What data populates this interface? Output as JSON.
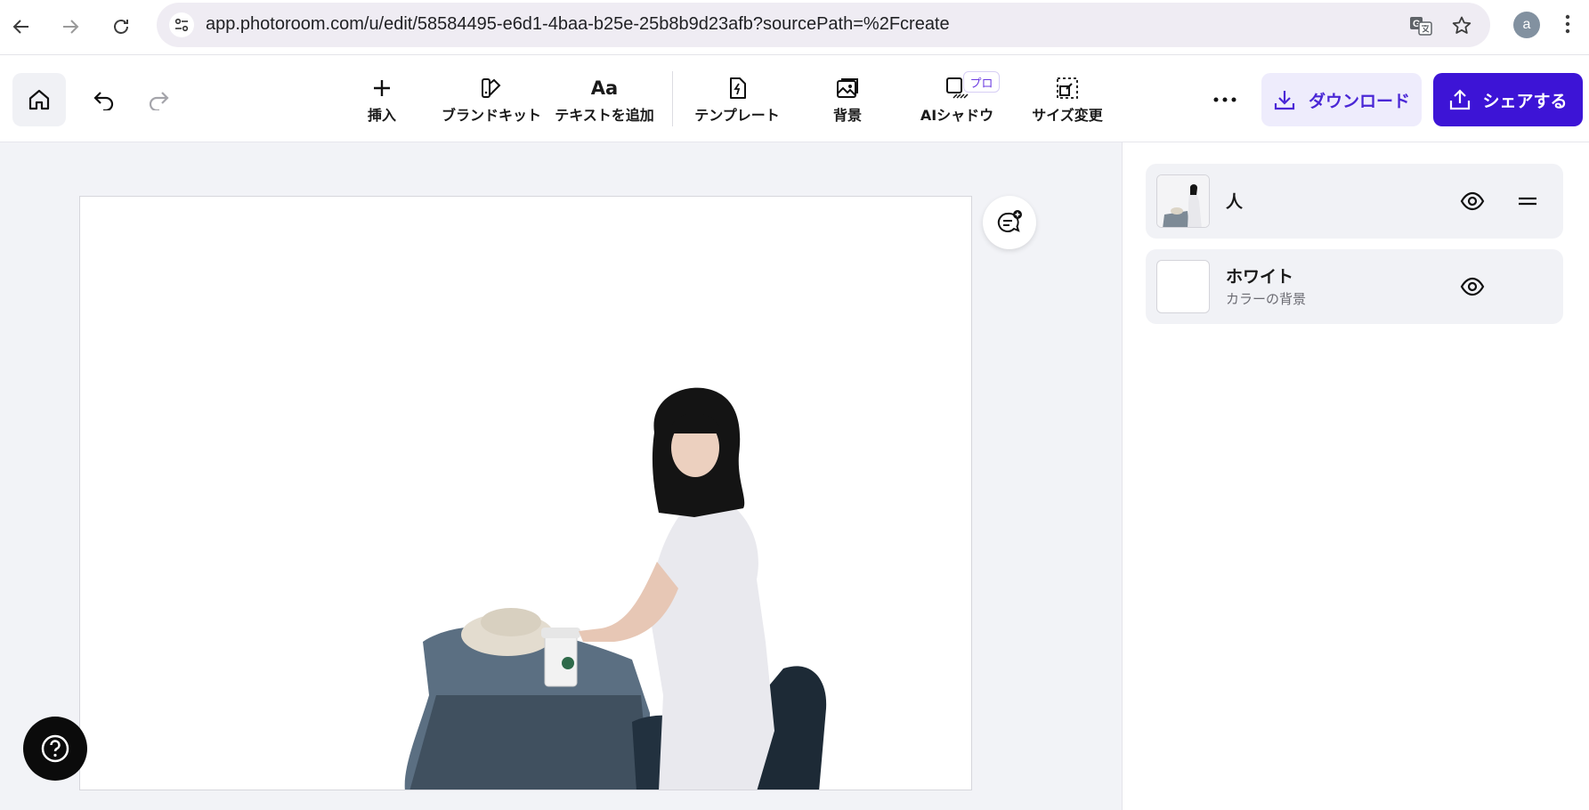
{
  "browser": {
    "url": "app.photoroom.com/u/edit/58584495-e6d1-4baa-b25e-25b8b9d23afb?sourcePath=%2Fcreate",
    "profile_initial": "a"
  },
  "toolbar": {
    "tools": [
      {
        "label": "挿入",
        "icon": "plus-icon"
      },
      {
        "label": "ブランドキット",
        "icon": "brand-kit-icon"
      },
      {
        "label": "テキストを追加",
        "icon": "text-icon",
        "glyph": "Aa"
      },
      {
        "label": "テンプレート",
        "icon": "template-icon"
      },
      {
        "label": "背景",
        "icon": "background-image-icon"
      },
      {
        "label": "AIシャドウ",
        "icon": "ai-shadow-icon"
      },
      {
        "label": "サイズ変更",
        "icon": "resize-icon"
      }
    ],
    "pro_badge": "プロ",
    "download_label": "ダウンロード",
    "share_label": "シェアする"
  },
  "layers": [
    {
      "name": "人",
      "subtitle": ""
    },
    {
      "name": "ホワイト",
      "subtitle": "カラーの背景"
    }
  ],
  "colors": {
    "accent": "#3d14d6",
    "accent_light": "#eeecfc",
    "workspace_bg": "#f2f3f7"
  }
}
